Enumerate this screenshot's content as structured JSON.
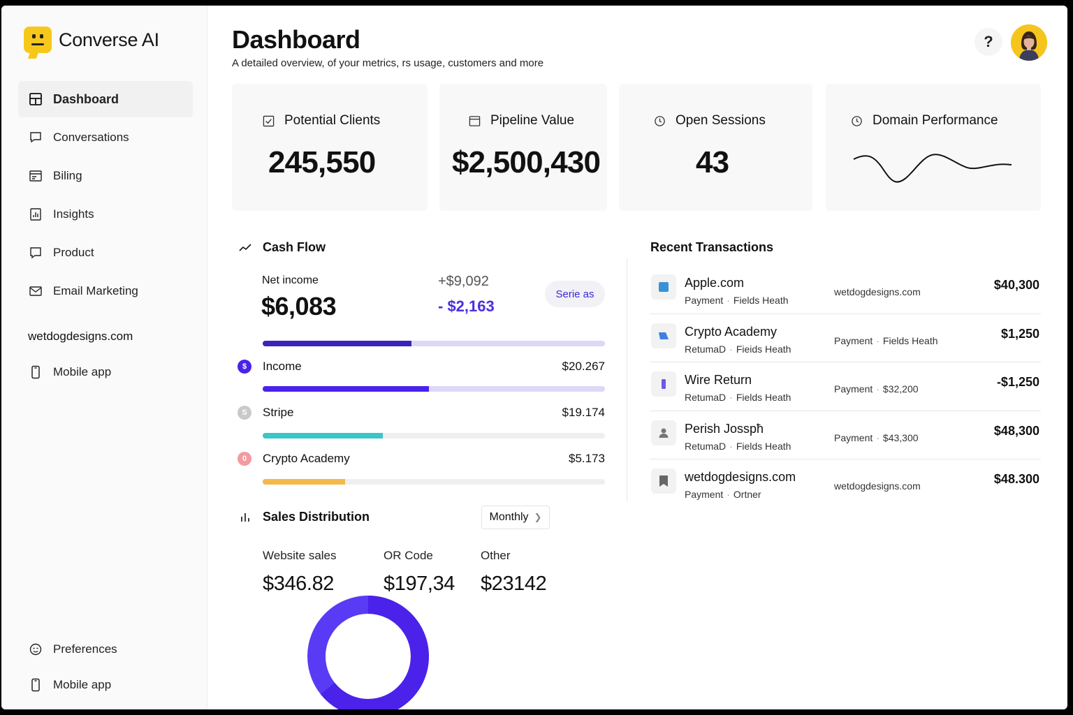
{
  "brand": {
    "name": "Converse AI"
  },
  "nav": {
    "items": [
      {
        "label": "Dashboard",
        "icon": "layout-icon"
      },
      {
        "label": "Conversations",
        "icon": "chat-icon"
      },
      {
        "label": "Biling",
        "icon": "billing-icon"
      },
      {
        "label": "Insights",
        "icon": "insights-icon"
      },
      {
        "label": "Product",
        "icon": "product-icon"
      },
      {
        "label": "Email Marketing",
        "icon": "mail-icon"
      }
    ],
    "section_label": "wetdogdesigns.com",
    "mobile_label": "Mobile app",
    "bottom": [
      {
        "label": "Preferences",
        "icon": "preferences-icon"
      },
      {
        "label": "Mobile app",
        "icon": "phone-icon"
      }
    ]
  },
  "header": {
    "title": "Dashboard",
    "subtitle": "A detailed overview, of your metrics, rs usage, customers and more",
    "help": "?"
  },
  "kpis": [
    {
      "label": "Potential Clients",
      "value": "245,550",
      "icon": "checkbox-icon"
    },
    {
      "label": "Pipeline Value",
      "value": "$2,500,430",
      "icon": "calendar-icon"
    },
    {
      "label": "Open Sessions",
      "value": "43",
      "icon": "clock-icon"
    },
    {
      "label": "Domain Performance",
      "icon": "clock-icon"
    }
  ],
  "cash_flow": {
    "title": "Cash Flow",
    "net_income_label": "Net income",
    "net_income_value": "$6,083",
    "delta_positive": "+$9,092",
    "delta_negative": "- $2,163",
    "series_button": "Serie as",
    "net_bar_fraction": 0.435,
    "rows": [
      {
        "label": "Income",
        "amount": "$20.267",
        "badge": "$",
        "color": "#4a22ea",
        "fraction": 0.485,
        "track": "#dcd8f8"
      },
      {
        "label": "Stripe",
        "amount": "$19.174",
        "badge": "S",
        "color": "#38c6c6",
        "fraction": 0.35,
        "track": "#efefef"
      },
      {
        "label": "Crypto Academy",
        "amount": "$5.173",
        "badge": "0",
        "color": "#f4b84a",
        "fraction": 0.24,
        "track": "#efefef"
      }
    ],
    "colors": {
      "net_fill": "#3a25b8",
      "net_track": "#dcd8f8",
      "stripe_badge": "#c9c9c9",
      "crypto_badge": "#f49aa0"
    }
  },
  "sales": {
    "title": "Sales Distribution",
    "period": "Monthly",
    "columns": [
      {
        "label": "Website sales",
        "value": "$346.82"
      },
      {
        "label": "OR Code",
        "value": "$197,34"
      },
      {
        "label": "Other",
        "value": "$23142"
      }
    ],
    "donut_colors": [
      "#5a3bf5",
      "#4a22ea"
    ]
  },
  "transactions": {
    "title": "Recent Transactions",
    "rows": [
      {
        "name": "Apple.com",
        "sub_a": "Payment",
        "sub_b": "Fields Heath",
        "mid_a": "wetdogdesigns.com",
        "mid_b": "",
        "amount": "$40,300",
        "icon": "square-app-icon"
      },
      {
        "name": "Crypto Academy",
        "sub_a": "RetumaD",
        "sub_b": "Fieids Heath",
        "mid_a": "Payment",
        "mid_b": "Fields Heath",
        "amount": "$1,250",
        "icon": "card-icon"
      },
      {
        "name": "Wire Return",
        "sub_a": "RetumaD",
        "sub_b": "Fields Heath",
        "mid_a": "Payment",
        "mid_b": "$32,200",
        "amount": "-$1,250",
        "icon": "device-icon"
      },
      {
        "name": "Perish Josspħ",
        "sub_a": "RetumaD",
        "sub_b": "Fields Heath",
        "mid_a": "Payment",
        "mid_b": "$43,300",
        "amount": "$48,300",
        "icon": "user-icon"
      },
      {
        "name": "wetdogdesigns.com",
        "sub_a": "Payment",
        "sub_b": "Ortner",
        "mid_a": "wetdogdesigns.com",
        "mid_b": "",
        "amount": "$48.300",
        "icon": "bookmark-icon"
      }
    ]
  }
}
